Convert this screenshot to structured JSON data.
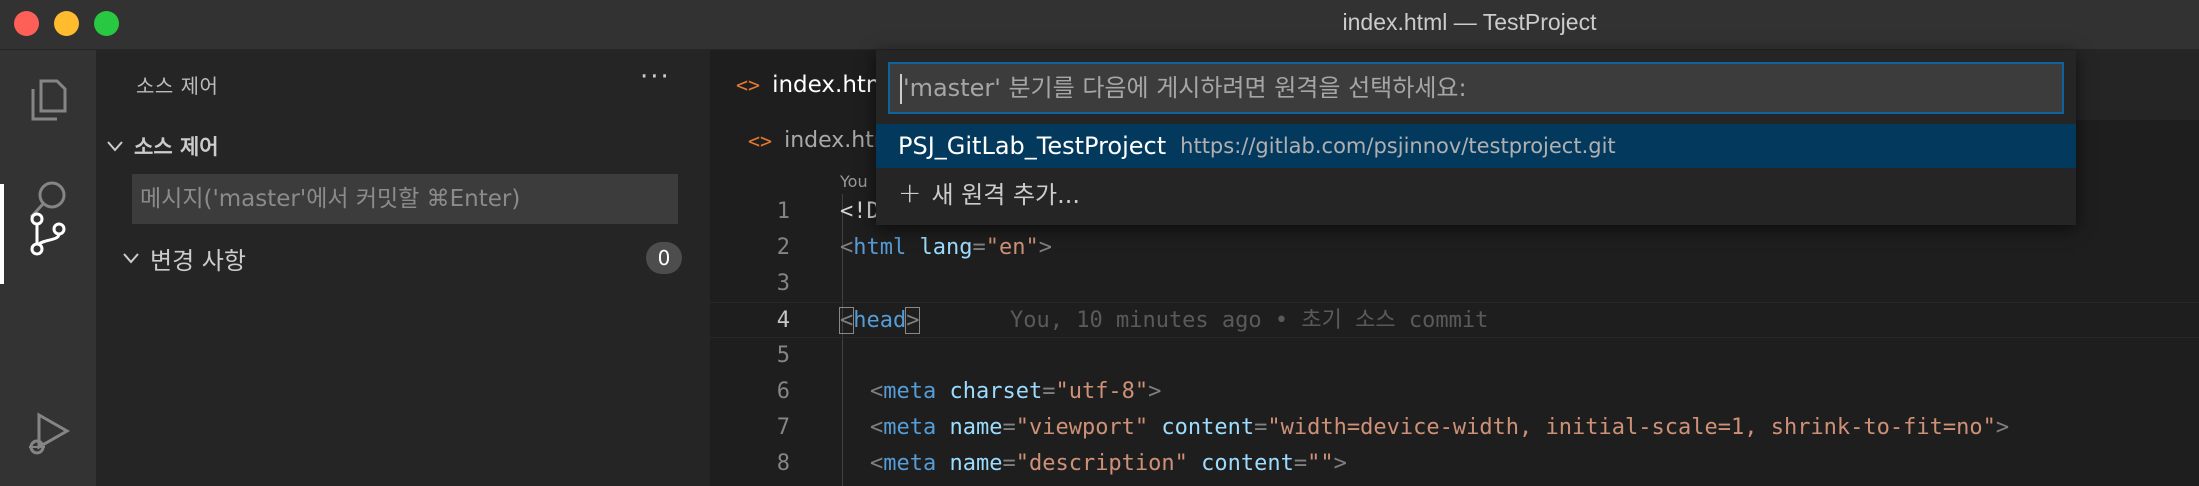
{
  "window": {
    "title": "index.html — TestProject"
  },
  "activity_bar": {
    "items": [
      {
        "icon": "files-icon",
        "active": false
      },
      {
        "icon": "search-icon",
        "active": false
      },
      {
        "icon": "source-control-icon",
        "active": true
      },
      {
        "icon": "run-debug-icon",
        "active": false
      }
    ]
  },
  "sidebar": {
    "title": "소스 제어",
    "more_label": "···",
    "section_title": "소스 제어",
    "commit_placeholder": "메시지('master'에서 커밋할 ⌘Enter)",
    "changes_label": "변경 사항",
    "changes_count": "0"
  },
  "editor": {
    "tab_label": "index.html",
    "tab_icon": "<>",
    "breadcrumb_label": "index.html",
    "codelens": "You",
    "lines": [
      {
        "num": "1",
        "text": "<!DOCTYPE html>"
      },
      {
        "num": "2",
        "text": "<html lang=\"en\">"
      },
      {
        "num": "3",
        "text": ""
      },
      {
        "num": "4",
        "text": "<head>",
        "blame": "You, 10 minutes ago • 초기 소스 commit"
      },
      {
        "num": "5",
        "text": ""
      },
      {
        "num": "6",
        "text": "<meta charset=\"utf-8\">"
      },
      {
        "num": "7",
        "text": "<meta name=\"viewport\" content=\"width=device-width, initial-scale=1, shrink-to-fit=no\">"
      },
      {
        "num": "8",
        "text": "<meta name=\"description\" content=\"\">"
      }
    ]
  },
  "quick_pick": {
    "placeholder": "'master' 분기를 다음에 게시하려면 원격을 선택하세요:",
    "items": [
      {
        "label": "PSJ_GitLab_TestProject",
        "description": "https://gitlab.com/psjinnov/testproject.git"
      },
      {
        "label": "새 원격 추가...",
        "icon": "+"
      }
    ]
  },
  "colors": {
    "accent": "#0e639c",
    "selection": "#04395e",
    "tag": "#569cd6",
    "attr": "#9cdcfe",
    "string": "#ce9178"
  }
}
